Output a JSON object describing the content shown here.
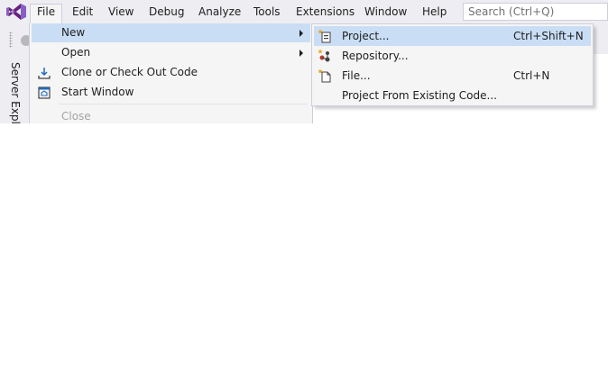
{
  "menubar": {
    "items": [
      {
        "id": "file",
        "label": "File",
        "active": true
      },
      {
        "id": "edit",
        "label": "Edit"
      },
      {
        "id": "view",
        "label": "View"
      },
      {
        "id": "debug",
        "label": "Debug"
      },
      {
        "id": "analyze",
        "label": "Analyze"
      },
      {
        "id": "tools",
        "label": "Tools"
      },
      {
        "id": "extensions",
        "label": "Extensions"
      },
      {
        "id": "window",
        "label": "Window"
      },
      {
        "id": "help",
        "label": "Help"
      }
    ],
    "search": {
      "placeholder": "Search (Ctrl+Q)"
    }
  },
  "side_panel": {
    "label": "Server Explorer"
  },
  "file_menu": {
    "items": [
      {
        "id": "new",
        "label": "New",
        "icon": "none",
        "submenu": true,
        "highlighted": true
      },
      {
        "id": "open",
        "label": "Open",
        "icon": "none",
        "submenu": true
      },
      {
        "id": "clone",
        "label": "Clone or Check Out Code",
        "icon": "download-icon"
      },
      {
        "id": "start-window",
        "label": "Start Window",
        "icon": "home-window-icon"
      },
      {
        "id": "close",
        "label": "Close",
        "icon": "none",
        "disabled": true
      }
    ]
  },
  "new_submenu": {
    "items": [
      {
        "id": "project",
        "label": "Project...",
        "shortcut": "Ctrl+Shift+N",
        "icon": "new-project-icon",
        "highlighted": true
      },
      {
        "id": "repository",
        "label": "Repository...",
        "shortcut": "",
        "icon": "repository-icon"
      },
      {
        "id": "file",
        "label": "File...",
        "shortcut": "Ctrl+N",
        "icon": "new-file-icon"
      },
      {
        "id": "existing",
        "label": "Project From Existing Code...",
        "shortcut": "",
        "icon": "none"
      }
    ]
  },
  "colors": {
    "chrome": "#eeeef2",
    "menu_bg": "#f5f5f5",
    "highlight": "#c9def5",
    "border": "#cccedb",
    "brand": "#865fc5",
    "disabled_text": "#a2a4a5"
  }
}
